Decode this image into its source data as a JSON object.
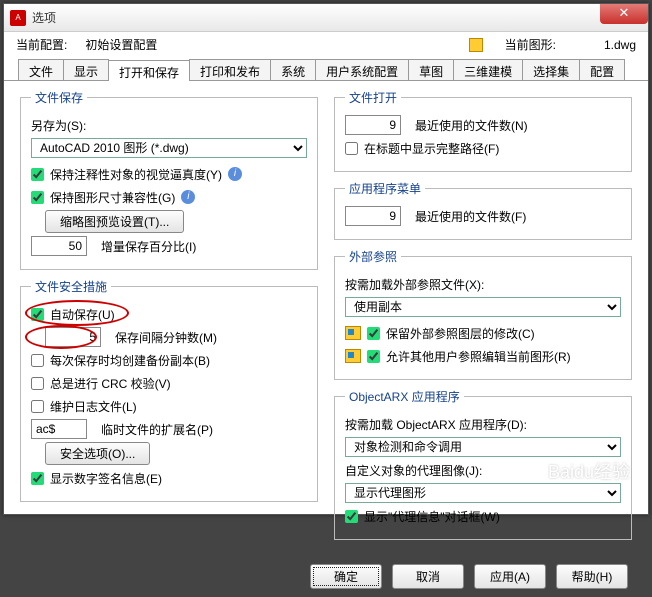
{
  "window": {
    "icon_text": "A",
    "title": "选项"
  },
  "profile": {
    "current_label": "当前配置:",
    "current_value": "初始设置配置",
    "drawing_label": "当前图形:",
    "drawing_value": "1.dwg"
  },
  "tabs": [
    "文件",
    "显示",
    "打开和保存",
    "打印和发布",
    "系统",
    "用户系统配置",
    "草图",
    "三维建模",
    "选择集",
    "配置"
  ],
  "active_tab": 2,
  "file_save": {
    "legend": "文件保存",
    "save_as": "另存为(S):",
    "format_value": "AutoCAD 2010 图形 (*.dwg)",
    "annotative": "保持注释性对象的视觉逼真度(Y)",
    "compatibility": "保持图形尺寸兼容性(G)",
    "thumbnail_btn": "缩略图预览设置(T)...",
    "percent_value": "50",
    "percent_label": "增量保存百分比(I)"
  },
  "file_safety": {
    "legend": "文件安全措施",
    "autosave": "自动保存(U)",
    "interval_value": "5",
    "interval_label": "保存间隔分钟数(M)",
    "backup": "每次保存时均创建备份副本(B)",
    "crc": "总是进行 CRC 校验(V)",
    "log": "维护日志文件(L)",
    "ext_value": "ac$",
    "ext_label": "临时文件的扩展名(P)",
    "security_btn": "安全选项(O)...",
    "signature": "显示数字签名信息(E)"
  },
  "file_open": {
    "legend": "文件打开",
    "recent_value": "9",
    "recent_label": "最近使用的文件数(N)",
    "fullpath": "在标题中显示完整路径(F)"
  },
  "app_menu": {
    "legend": "应用程序菜单",
    "recent_value": "9",
    "recent_label": "最近使用的文件数(F)"
  },
  "xref": {
    "legend": "外部参照",
    "load_label": "按需加载外部参照文件(X):",
    "load_value": "使用副本",
    "retain": "保留外部参照图层的修改(C)",
    "allow": "允许其他用户参照编辑当前图形(R)"
  },
  "arx": {
    "legend": "ObjectARX 应用程序",
    "demand_label": "按需加载 ObjectARX 应用程序(D):",
    "demand_value": "对象检测和命令调用",
    "proxy_label": "自定义对象的代理图像(J):",
    "proxy_value": "显示代理图形",
    "show_proxy": "显示\"代理信息\"对话框(W)"
  },
  "buttons": {
    "ok": "确定",
    "cancel": "取消",
    "apply": "应用(A)",
    "help": "帮助(H)"
  },
  "watermark": "Baidu经验"
}
